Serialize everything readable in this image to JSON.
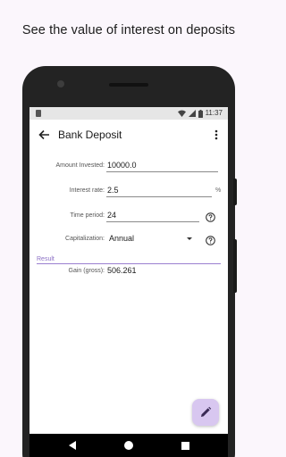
{
  "promo": {
    "caption": "See the value of interest on deposits"
  },
  "status_bar": {
    "time": "11:37"
  },
  "toolbar": {
    "title": "Bank Deposit"
  },
  "form": {
    "amount": {
      "label": "Amount Invested:",
      "value": "10000.0"
    },
    "rate": {
      "label": "Interest rate:",
      "value": "2.5",
      "unit": "%"
    },
    "period": {
      "label": "Time period:",
      "value": "24"
    },
    "capitalization": {
      "label": "Capitalization:",
      "value": "Annual"
    }
  },
  "result": {
    "section_label": "Result",
    "gain": {
      "label": "Gain (gross):",
      "value": "506.261"
    }
  },
  "colors": {
    "accent": "#8b6fc4",
    "fab": "#d8c7f0",
    "background": "#fbf6fc"
  },
  "icons": [
    "back-arrow-icon",
    "more-vert-icon",
    "help-icon",
    "dropdown-arrow-icon",
    "edit-pencil-icon",
    "wifi-icon",
    "signal-icon",
    "battery-icon",
    "nav-back-icon",
    "nav-home-icon",
    "nav-recents-icon"
  ]
}
